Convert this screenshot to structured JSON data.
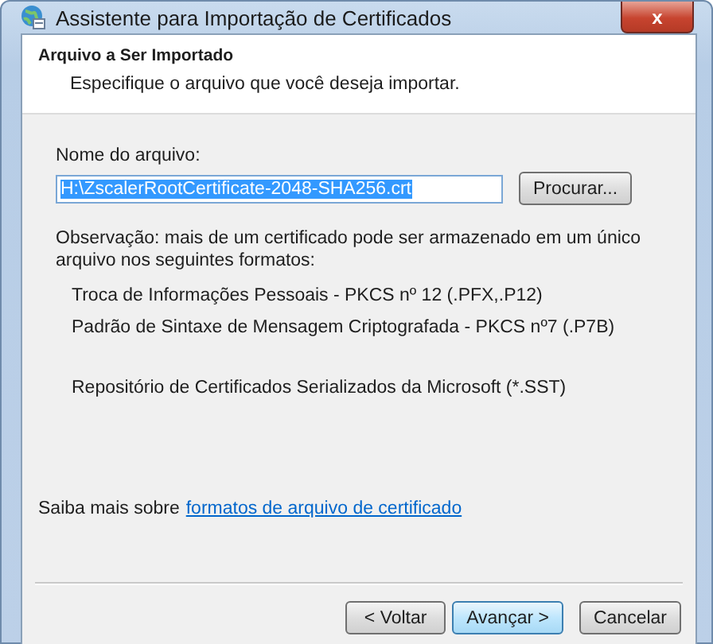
{
  "window": {
    "title": "Assistente para Importação de Certificados",
    "close": "x"
  },
  "header": {
    "title": "Arquivo a Ser Importado",
    "subtitle": "Especifique o arquivo que você deseja importar."
  },
  "file_field": {
    "label": "Nome do arquivo:",
    "value": "H:\\ZscalerRootCertificate-2048-SHA256.crt",
    "value_selected": true,
    "browse_button": "Procurar..."
  },
  "note": "Observação: mais de um certificado pode ser armazenado em um único arquivo nos seguintes formatos:",
  "formats": [
    "Troca de Informações Pessoais - PKCS nº 12 (.PFX,.P12)",
    "Padrão de Sintaxe de Mensagem Criptografada - PKCS nº7 (.P7B)",
    "Repositório de Certificados Serializados da Microsoft (*.SST)"
  ],
  "more_info": {
    "text": "Saiba mais sobre",
    "link": "formatos de arquivo de certificado"
  },
  "buttons": [
    {
      "label": "< Voltar",
      "default": false
    },
    {
      "label": "Avançar >",
      "default": true
    },
    {
      "label": "Cancelar",
      "default": false
    }
  ]
}
